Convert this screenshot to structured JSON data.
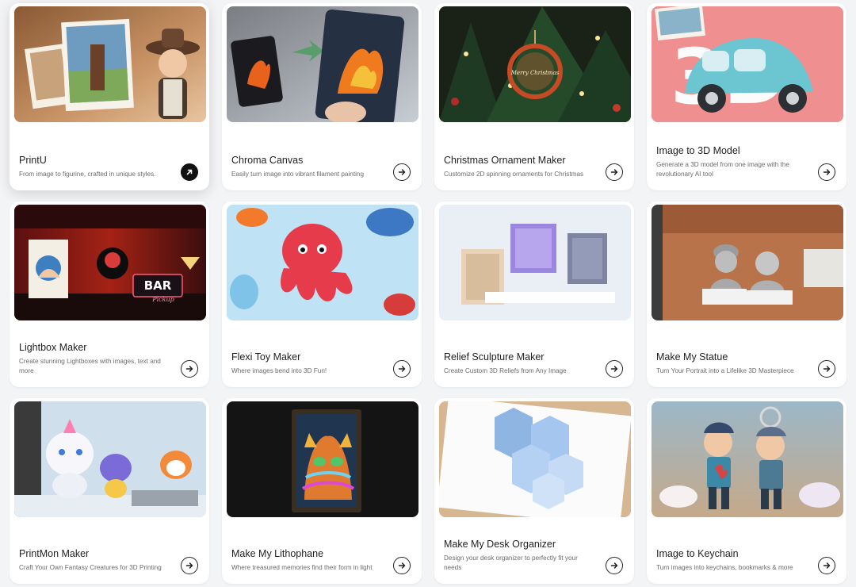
{
  "cards": [
    {
      "title": "PrintU",
      "desc": "From image to figurine, crafted in unique styles.",
      "thumb": "figurine-cowboy",
      "active": true
    },
    {
      "title": "Chroma Canvas",
      "desc": "Easily turn image into vibrant filament painting",
      "thumb": "phoenix-canvas"
    },
    {
      "title": "Christmas Ornament Maker",
      "desc": "Customize 2D spinning ornaments for Christmas",
      "thumb": "christmas-tree"
    },
    {
      "title": "Image to 3D Model",
      "desc": "Generate a 3D model from one image with the revolutionary AI tool",
      "thumb": "3d-car"
    },
    {
      "title": "Lightbox Maker",
      "desc": "Create stunning Lightboxes with images, text and more",
      "thumb": "lightbox-bar"
    },
    {
      "title": "Flexi Toy Maker",
      "desc": "Where images bend into 3D Fun!",
      "thumb": "octopus-toy"
    },
    {
      "title": "Relief Sculpture Maker",
      "desc": "Create Custom 3D Reliefs from Any Image",
      "thumb": "relief-panels"
    },
    {
      "title": "Make My Statue",
      "desc": "Turn Your Portrait into a Lifelike 3D Masterpiece",
      "thumb": "statues"
    },
    {
      "title": "PrintMon Maker",
      "desc": "Craft Your Own Fantasy Creatures for 3D Printing",
      "thumb": "creatures"
    },
    {
      "title": "Make My Lithophane",
      "desc": "Where treasured memories find their form in light",
      "thumb": "cat-lithophane"
    },
    {
      "title": "Make My Desk Organizer",
      "desc": "Design your desk organizer to perfectly fit your needs",
      "thumb": "hex-organizer"
    },
    {
      "title": "Image to Keychain",
      "desc": "Turn images into keychains, bookmarks & more",
      "thumb": "keychains"
    }
  ],
  "thumb_text": {
    "ornament": "Merry Christmas",
    "three_d": "3D",
    "bar_sign": "BAR",
    "bar_script": "Pickup"
  },
  "colors": {
    "arrow_border": "#222222",
    "card_bg": "#ffffff",
    "page_bg": "#f3f4f6"
  }
}
